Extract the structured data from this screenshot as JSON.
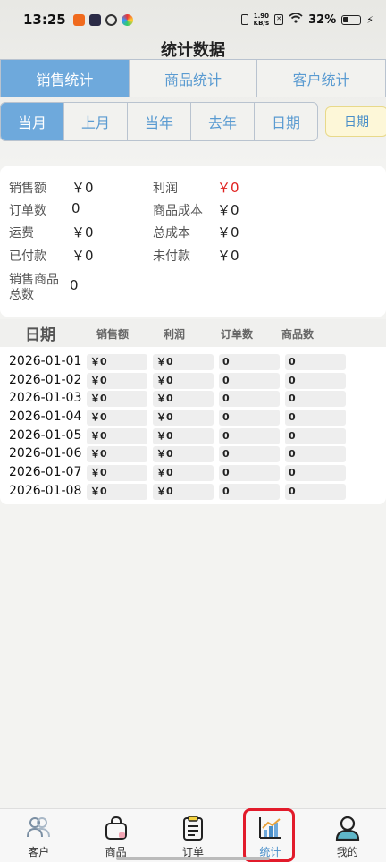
{
  "status": {
    "time": "13:25",
    "speed_value": "1.90",
    "speed_unit": "KB/s",
    "battery": "32%"
  },
  "title": "统计数据",
  "category_tabs": [
    {
      "label": "销售统计",
      "active": true
    },
    {
      "label": "商品统计",
      "active": false
    },
    {
      "label": "客户统计",
      "active": false
    }
  ],
  "period_tabs": [
    {
      "label": "当月",
      "active": true
    },
    {
      "label": "上月",
      "active": false
    },
    {
      "label": "当年",
      "active": false
    },
    {
      "label": "去年",
      "active": false
    },
    {
      "label": "日期",
      "active": false
    }
  ],
  "date_button": "日期",
  "summary": {
    "sales_label": "销售额",
    "sales_value": "￥0",
    "profit_label": "利润",
    "profit_value": "￥0",
    "orders_label": "订单数",
    "orders_value": "0",
    "goods_cost_label": "商品成本",
    "goods_cost_value": "￥0",
    "shipping_label": "运费",
    "shipping_value": "￥0",
    "total_cost_label": "总成本",
    "total_cost_value": "￥0",
    "paid_label": "已付款",
    "paid_value": "￥0",
    "unpaid_label": "未付款",
    "unpaid_value": "￥0",
    "goods_total_label_1": "销售商品",
    "goods_total_label_2": "总数",
    "goods_total_value": "0"
  },
  "table": {
    "headers": [
      "日期",
      "销售额",
      "利润",
      "订单数",
      "商品数"
    ],
    "rows": [
      {
        "date": "2026-01-01",
        "sales": "￥0",
        "profit": "￥0",
        "orders": "0",
        "goods": "0"
      },
      {
        "date": "2026-01-02",
        "sales": "￥0",
        "profit": "￥0",
        "orders": "0",
        "goods": "0"
      },
      {
        "date": "2026-01-03",
        "sales": "￥0",
        "profit": "￥0",
        "orders": "0",
        "goods": "0"
      },
      {
        "date": "2026-01-04",
        "sales": "￥0",
        "profit": "￥0",
        "orders": "0",
        "goods": "0"
      },
      {
        "date": "2026-01-05",
        "sales": "￥0",
        "profit": "￥0",
        "orders": "0",
        "goods": "0"
      },
      {
        "date": "2026-01-06",
        "sales": "￥0",
        "profit": "￥0",
        "orders": "0",
        "goods": "0"
      },
      {
        "date": "2026-01-07",
        "sales": "￥0",
        "profit": "￥0",
        "orders": "0",
        "goods": "0"
      },
      {
        "date": "2026-01-08",
        "sales": "￥0",
        "profit": "￥0",
        "orders": "0",
        "goods": "0"
      }
    ]
  },
  "nav": [
    {
      "label": "客户",
      "icon": "customers-icon",
      "active": false
    },
    {
      "label": "商品",
      "icon": "bag-icon",
      "active": false
    },
    {
      "label": "订单",
      "icon": "clipboard-icon",
      "active": false
    },
    {
      "label": "统计",
      "icon": "chart-icon",
      "active": true
    },
    {
      "label": "我的",
      "icon": "person-icon",
      "active": false
    }
  ],
  "colors": {
    "accent": "#6ea9dc",
    "profit_red": "#e0211f",
    "highlight": "#e21b2b"
  }
}
